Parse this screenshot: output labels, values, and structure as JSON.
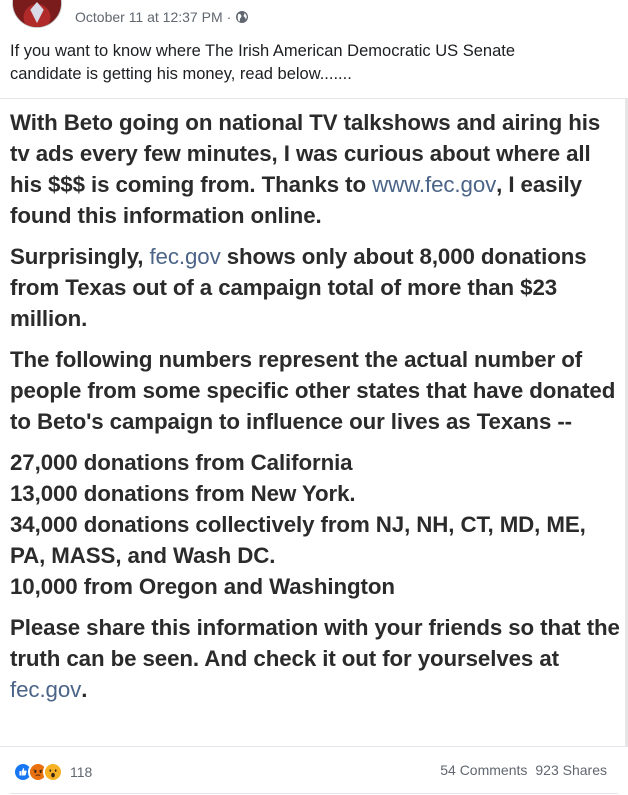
{
  "post": {
    "timestamp": "October 11 at 12:37 PM",
    "separator": "·",
    "privacy_icon": "globe-icon",
    "caption": "If you want to know where The Irish American Democratic US Senate candidate is getting his money, read below......."
  },
  "image_text": {
    "p1_before": "With Beto going on national TV talkshows and airing his tv ads every few minutes, I was curious about where all his $$$ is coming from. Thanks to ",
    "p1_link": "www.fec.gov",
    "p1_after": ", I easily found this information online.",
    "p2_before": "Surprisingly, ",
    "p2_link": "fec.gov",
    "p2_after": " shows only about 8,000 donations from Texas out of a campaign total of more than $23 million.",
    "p3": "The following numbers represent the actual number of people from some specific other states that have donated to Beto's campaign to influence our lives as Texans --",
    "list": [
      "27,000 donations from California",
      "13,000 donations from New York.",
      "34,000 donations collectively from NJ, NH, CT, MD, ME, PA, MASS, and Wash DC.",
      "10,000 from Oregon and Washington"
    ],
    "p4_before": "Please share this information with your friends so that the truth can be seen. And check it out for yourselves at ",
    "p4_link": "fec.gov",
    "p4_after": "."
  },
  "footer": {
    "reaction_icons": [
      "like-icon",
      "angry-icon",
      "wow-icon"
    ],
    "reaction_count": "118",
    "comments": "54 Comments",
    "shares": "923 Shares"
  },
  "colors": {
    "like": "#1877f2",
    "angry": "#e9710f",
    "wow": "#f7b125",
    "link": "#4b6487",
    "meta": "#616770"
  }
}
